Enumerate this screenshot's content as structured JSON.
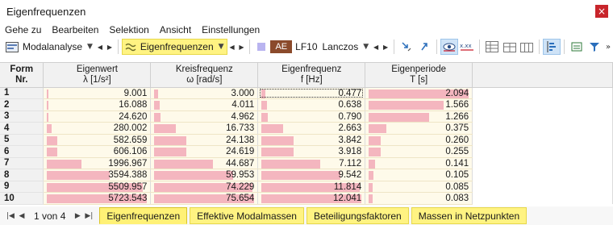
{
  "window": {
    "title": "Eigenfrequenzen",
    "close_label": "×"
  },
  "menu": [
    "Gehe zu",
    "Bearbeiten",
    "Selektion",
    "Ansicht",
    "Einstellungen"
  ],
  "toolbar": {
    "analysis_select": "Modalanalyse",
    "result_select": "Eigenfrequenzen",
    "load_case_badge": "AE",
    "load_case_id": "LF10",
    "solver_select": "Lanczos",
    "swatch_color": "#b9b4f0",
    "badge_color": "#8b4a2b"
  },
  "table": {
    "headers": [
      {
        "line1": "Form",
        "line2": "Nr."
      },
      {
        "line1": "Eigenwert",
        "line2": "λ [1/s²]"
      },
      {
        "line1": "Kreisfrequenz",
        "line2": "ω [rad/s]"
      },
      {
        "line1": "Eigenfrequenz",
        "line2": "f [Hz]"
      },
      {
        "line1": "Eigenperiode",
        "line2": "T [s]"
      }
    ],
    "rows": [
      {
        "form": "1",
        "lambda": "9.001",
        "omega": "3.000",
        "f": "0.477",
        "t": "2.094"
      },
      {
        "form": "2",
        "lambda": "16.088",
        "omega": "4.011",
        "f": "0.638",
        "t": "1.566"
      },
      {
        "form": "3",
        "lambda": "24.620",
        "omega": "4.962",
        "f": "0.790",
        "t": "1.266"
      },
      {
        "form": "4",
        "lambda": "280.002",
        "omega": "16.733",
        "f": "2.663",
        "t": "0.375"
      },
      {
        "form": "5",
        "lambda": "582.659",
        "omega": "24.138",
        "f": "3.842",
        "t": "0.260"
      },
      {
        "form": "6",
        "lambda": "606.106",
        "omega": "24.619",
        "f": "3.918",
        "t": "0.255"
      },
      {
        "form": "7",
        "lambda": "1996.967",
        "omega": "44.687",
        "f": "7.112",
        "t": "0.141"
      },
      {
        "form": "8",
        "lambda": "3594.388",
        "omega": "59.953",
        "f": "9.542",
        "t": "0.105"
      },
      {
        "form": "9",
        "lambda": "5509.957",
        "omega": "74.229",
        "f": "11.814",
        "t": "0.085"
      },
      {
        "form": "10",
        "lambda": "5723.543",
        "omega": "75.654",
        "f": "12.041",
        "t": "0.083"
      }
    ],
    "bar_color": "#f4b6bf",
    "selected_cell": {
      "row": 0,
      "column": "f"
    }
  },
  "statusbar": {
    "page_text": "1 von 4",
    "tabs": [
      "Eigenfrequenzen",
      "Effektive Modalmassen",
      "Beteiligungsfaktoren",
      "Massen in Netzpunkten"
    ],
    "active_tab": 0
  }
}
